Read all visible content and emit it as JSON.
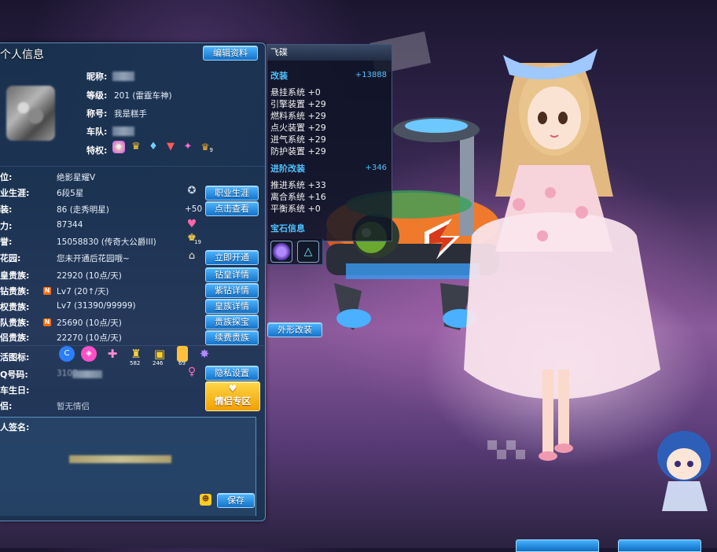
{
  "profile": {
    "title": "个人信息",
    "edit_button": "编辑资料",
    "nickname_label": "昵称:",
    "level_label": "等级:",
    "level_value": "201 (雷霆车神)",
    "title_label": "称号:",
    "title_value": "我是糕手",
    "team_label": "车队:",
    "privilege_label": "特权:",
    "privilege_last_badge": "9"
  },
  "details": [
    {
      "label": "位:",
      "value": "绝影星耀Ⅴ",
      "button": ""
    },
    {
      "label": "业生涯:",
      "value": "6段5星",
      "button": "职业生涯"
    },
    {
      "label": "装:",
      "value": "86 (走秀明星)",
      "extra": "+50",
      "button": "点击查看"
    },
    {
      "label": "力:",
      "value": "87344",
      "button": ""
    },
    {
      "label": "誉:",
      "value": "15058830 (传奇大公爵III)",
      "extra": "19",
      "button": ""
    },
    {
      "label": "花园:",
      "value": "您未开通后花园哦~",
      "button": "立即开通"
    },
    {
      "label": "皇贵族:",
      "value": "22920 (10点/天)",
      "button": "钻皇详情"
    },
    {
      "label": "钻贵族:",
      "value": "Lv7 (20↑/天)",
      "badge": "N",
      "button": "紫钻详情"
    },
    {
      "label": "权贵族:",
      "value": "Lv7 (31390/99999)",
      "button": "皇族详情"
    },
    {
      "label": "队贵族:",
      "value": "25690 (10点/天)",
      "badge": "N",
      "button": "贵族探宝"
    },
    {
      "label": "侣贵族:",
      "value": "22270 (10点/天)",
      "button": "续费贵族"
    }
  ],
  "activity": {
    "label": "活图标:",
    "icon_counts": [
      "582",
      "246",
      "69"
    ]
  },
  "qq": {
    "label": "Q号码:",
    "value": "3100",
    "button": "隐私设置"
  },
  "birthday": {
    "label": "车生日:"
  },
  "partner": {
    "label": "侣:",
    "value": "暂无情侣",
    "button": "情侣专区"
  },
  "signature": {
    "label": "人签名:",
    "save_button": "保存"
  },
  "stats": {
    "header": "飞碟",
    "mod_title": "改装",
    "mod_total": "+13888",
    "mods": [
      {
        "name": "悬挂系统",
        "value": "+0"
      },
      {
        "name": "引擎装置",
        "value": "+29"
      },
      {
        "name": "燃料系统",
        "value": "+29"
      },
      {
        "name": "点火装置",
        "value": "+29"
      },
      {
        "name": "进气系统",
        "value": "+29"
      },
      {
        "name": "防护装置",
        "value": "+29"
      }
    ],
    "adv_title": "进阶改装",
    "adv_total": "+346",
    "adv": [
      {
        "name": "推进系统",
        "value": "+33"
      },
      {
        "name": "离合系统",
        "value": "+16"
      },
      {
        "name": "平衡系统",
        "value": "+0"
      }
    ],
    "gem_title": "宝石信息"
  },
  "appearance_button": "外形改装",
  "colors": {
    "accent": "#4ec3ff",
    "button": "#1573c9",
    "gold": "#f0a000"
  }
}
